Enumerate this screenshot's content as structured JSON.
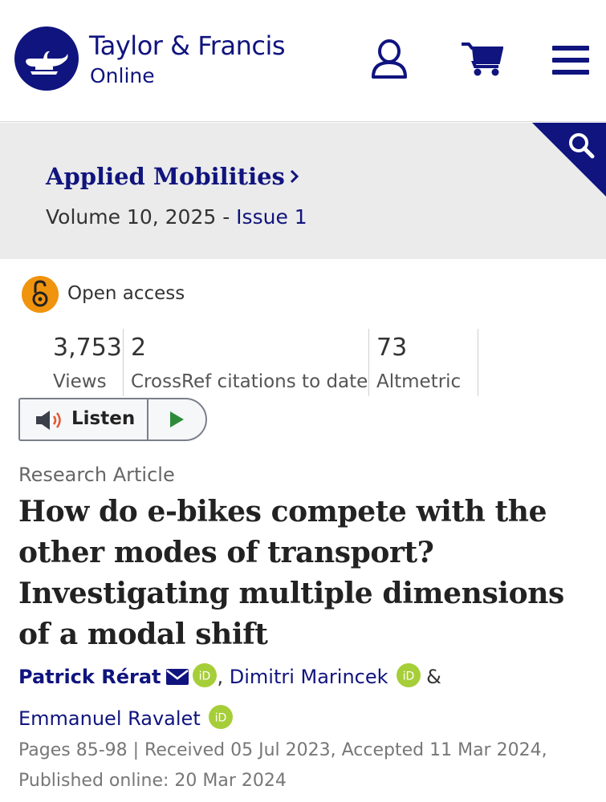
{
  "header": {
    "brand_title": "Taylor & Francis",
    "brand_sub": "Online",
    "icons": [
      "lamp-logo-icon",
      "user-icon",
      "cart-icon",
      "menu-icon"
    ],
    "brand_color": "#10147e"
  },
  "journal": {
    "name": "Applied Mobilities",
    "volume_text": "Volume 10, 2025 - ",
    "issue_link": "Issue 1",
    "search_icon": "search-icon"
  },
  "access": {
    "label": "Open access",
    "icon": "open-lock-icon",
    "color": "#f0930d"
  },
  "metrics": [
    {
      "value": "3,753",
      "label": "Views"
    },
    {
      "value": "2",
      "label": "CrossRef citations to date"
    },
    {
      "value": "73",
      "label": "Altmetric"
    }
  ],
  "listen": {
    "label": "Listen",
    "speaker_icon": "speaker-icon",
    "play_icon": "play-icon"
  },
  "article": {
    "type": "Research Article",
    "title": "How do e-bikes compete with the other modes of transport? Investigating multiple dimensions of a modal shift",
    "authors": [
      {
        "name": "Patrick Rérat"
      },
      {
        "name": "Dimitri Marincek"
      },
      {
        "name": "Emmanuel Ravalet"
      }
    ],
    "author_sep_comma": ", ",
    "author_sep_amp": " &",
    "pub_info": "Pages 85-98 | Received 05 Jul 2023, Accepted 11 Mar 2024, Published online: 20 Mar 2024"
  }
}
